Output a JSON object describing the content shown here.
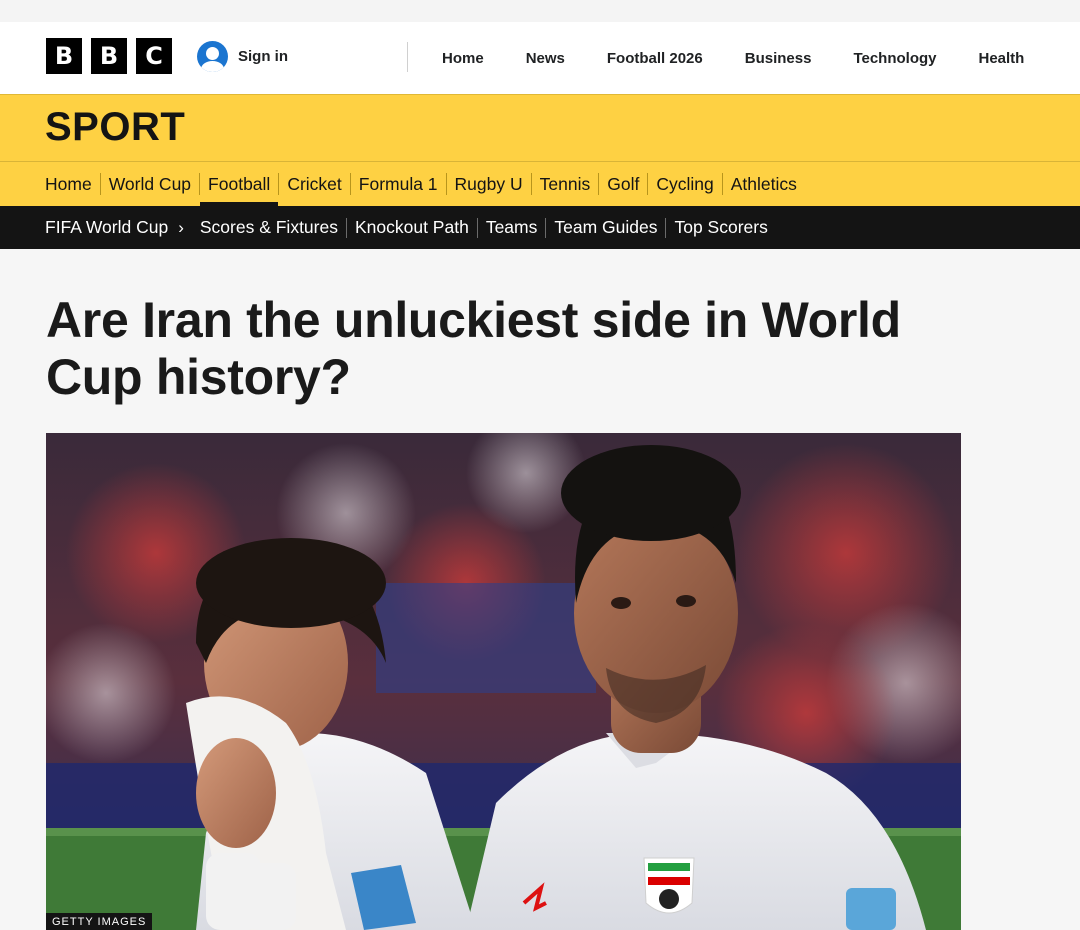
{
  "header": {
    "logo_letters": [
      "B",
      "B",
      "C"
    ],
    "signin_label": "Sign in",
    "nav": [
      "Home",
      "News",
      "Football 2026",
      "Business",
      "Technology",
      "Health"
    ]
  },
  "sport": {
    "title": "SPORT",
    "nav": [
      "Home",
      "World Cup",
      "Football",
      "Cricket",
      "Formula 1",
      "Rugby U",
      "Tennis",
      "Golf",
      "Cycling",
      "Athletics"
    ],
    "active_item": "Football"
  },
  "subnav": {
    "section": "FIFA World Cup",
    "items": [
      "Scores & Fixtures",
      "Knockout Path",
      "Teams",
      "Team Guides",
      "Top Scorers"
    ]
  },
  "article": {
    "headline": "Are Iran the unluckiest side in World Cup history?",
    "image_credit": "GETTY IMAGES",
    "image_description_icon": "photo-of-iran-players"
  },
  "colors": {
    "sport_yellow": "#fed143",
    "subnav_black": "#141414",
    "signin_blue": "#1b75d0"
  }
}
